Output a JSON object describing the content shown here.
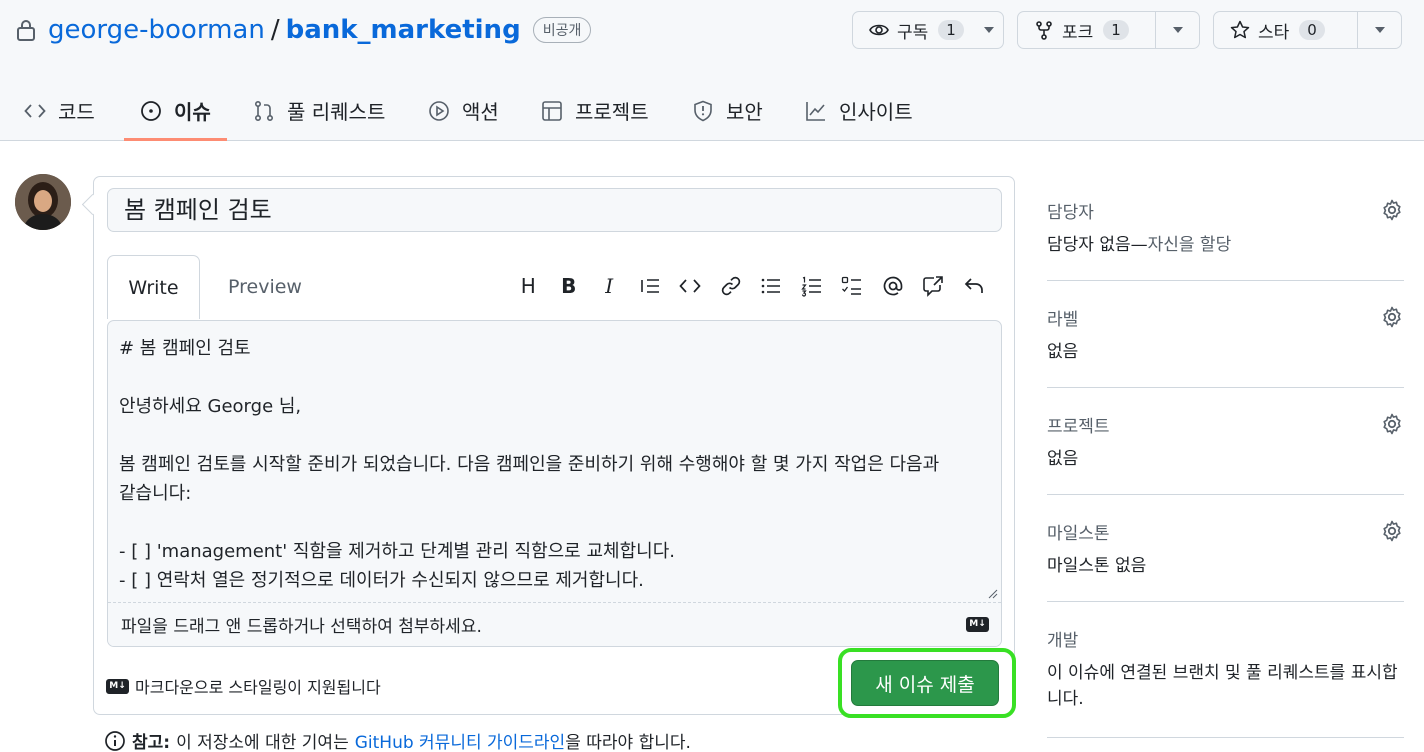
{
  "repo": {
    "owner": "george-boorman",
    "slash": "/",
    "name": "bank_marketing",
    "visibility": "비공개"
  },
  "actions": {
    "watch": {
      "label": "구독",
      "count": "1"
    },
    "fork": {
      "label": "포크",
      "count": "1"
    },
    "star": {
      "label": "스타",
      "count": "0"
    }
  },
  "nav": {
    "code": "코드",
    "issues": "이슈",
    "pulls": "풀 리퀘스트",
    "actions": "액션",
    "projects": "프로젝트",
    "security": "보안",
    "insights": "인사이트"
  },
  "issue": {
    "title": "봄 캠페인 검토",
    "write_tab": "Write",
    "preview_tab": "Preview",
    "body": "# 봄 캠페인 검토\n\n안녕하세요 George 님,\n\n봄 캠페인 검토를 시작할 준비가 되었습니다. 다음 캠페인을 준비하기 위해 수행해야 할 몇 가지 작업은 다음과 같습니다:\n\n- [ ] 'management' 직함을 제거하고 단계별 관리 직함으로 교체합니다.\n- [ ] 연락처 열은 정기적으로 데이터가 수신되지 않으므로 제거합니다.",
    "attach_hint": "파일을 드래그 앤 드롭하거나 선택하여 첨부하세요.",
    "markdown_note": "마크다운으로 스타일링이 지원됩니다",
    "md_badge": "M↓",
    "submit": "새 이슈 제출"
  },
  "toolbar": {
    "heading": "H",
    "bold": "B",
    "italic": "I"
  },
  "note": {
    "label": "참고:",
    "before": "이 저장소에 대한 기여는",
    "link": "GitHub 커뮤니티 가이드라인",
    "after": "을 따라야 합니다."
  },
  "sidebar": {
    "assignees": {
      "label": "담당자",
      "value": "담당자 없음—",
      "link": "자신을 할당"
    },
    "labels": {
      "label": "라벨",
      "value": "없음"
    },
    "projects": {
      "label": "프로젝트",
      "value": "없음"
    },
    "milestone": {
      "label": "마일스톤",
      "value": "마일스톤 없음"
    },
    "development": {
      "label": "개발",
      "value_line1": "이 이슈에 연결된 브랜치 및 풀 리퀘스트를 표시합",
      "value_line2": "니다."
    }
  }
}
